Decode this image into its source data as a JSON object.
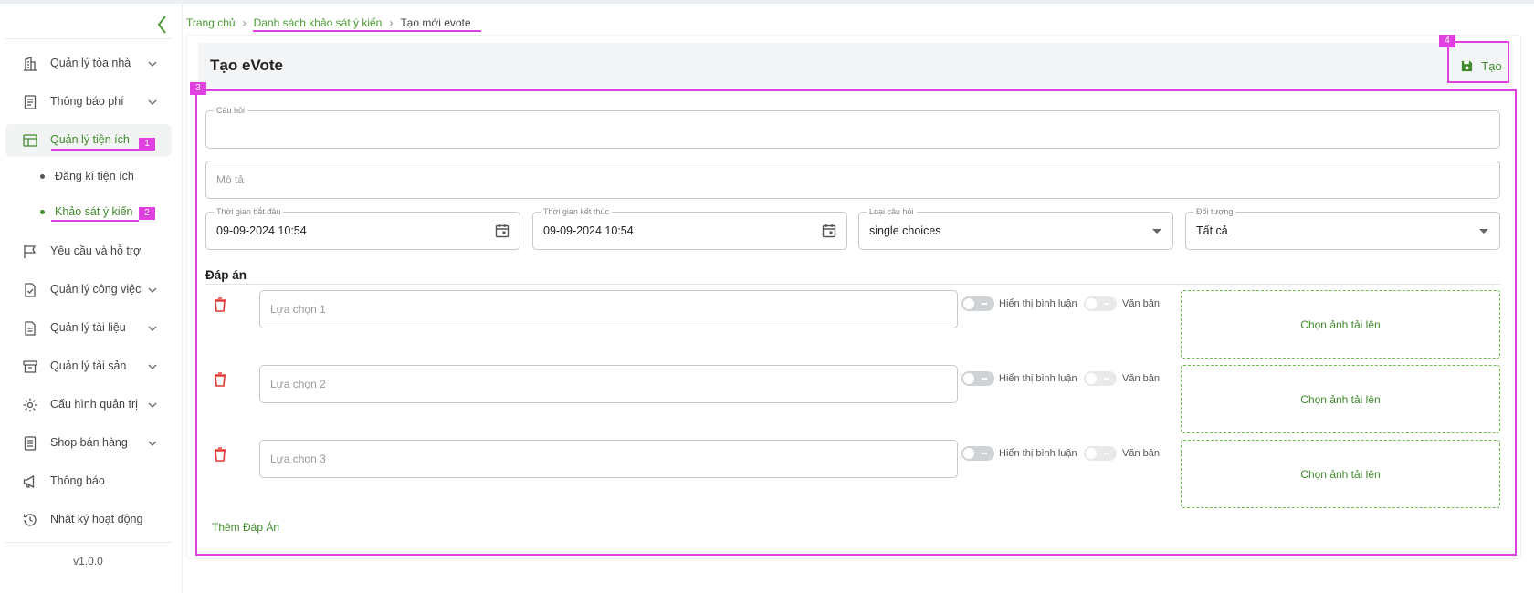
{
  "breadcrumb": {
    "home": "Trang chủ",
    "list": "Danh sách khảo sát ý kiến",
    "current": "Tạo mới evote"
  },
  "sidebar": {
    "items": [
      {
        "label": "Quản lý tòa nhà",
        "icon": "building-icon"
      },
      {
        "label": "Thông báo phí",
        "icon": "receipt-icon"
      },
      {
        "label": "Quản lý tiện ích",
        "icon": "layout-icon"
      },
      {
        "label": "Yêu cầu và hỗ trợ",
        "icon": "flag-icon"
      },
      {
        "label": "Quản lý công việc",
        "icon": "task-icon"
      },
      {
        "label": "Quản lý tài liệu",
        "icon": "document-icon"
      },
      {
        "label": "Quản lý tài sản",
        "icon": "archive-icon"
      },
      {
        "label": "Cấu hình quản trị",
        "icon": "gear-icon"
      },
      {
        "label": "Shop bán hàng",
        "icon": "shop-icon"
      },
      {
        "label": "Thông báo",
        "icon": "megaphone-icon"
      },
      {
        "label": "Nhật ký hoạt động",
        "icon": "history-icon"
      }
    ],
    "sub_items": [
      {
        "label": "Đăng kí tiện ích"
      },
      {
        "label": "Khảo sát ý kiến"
      }
    ],
    "version": "v1.0.0"
  },
  "page": {
    "title": "Tạo eVote",
    "create_label": "Tạo",
    "question_label": "Câu hỏi",
    "description_placeholder": "Mô tả",
    "start_label": "Thời gian bắt đầu",
    "start_value": "09-09-2024 10:54",
    "end_label": "Thời gian kết thúc",
    "end_value": "09-09-2024 10:54",
    "type_label": "Loại câu hỏi",
    "type_value": "single choices",
    "target_label": "Đối tượng",
    "target_value": "Tất cả",
    "answers_title": "Đáp án",
    "add_answer": "Thêm Đáp Án"
  },
  "answers": [
    {
      "placeholder": "Lựa chọn 1",
      "show_comment": "Hiển thị bình luận",
      "text_label": "Văn bản",
      "upload": "Chọn ảnh tải lên"
    },
    {
      "placeholder": "Lựa chọn 2",
      "show_comment": "Hiển thị bình luận",
      "text_label": "Văn bản",
      "upload": "Chọn ảnh tải lên"
    },
    {
      "placeholder": "Lựa chọn 3",
      "show_comment": "Hiển thị bình luận",
      "text_label": "Văn bản",
      "upload": "Chọn ảnh tải lên"
    }
  ],
  "annotations": [
    "1",
    "2",
    "3",
    "4"
  ],
  "colors": {
    "accent": "#3f8a2a",
    "annotation": "#e040e0",
    "danger": "#e53935"
  }
}
